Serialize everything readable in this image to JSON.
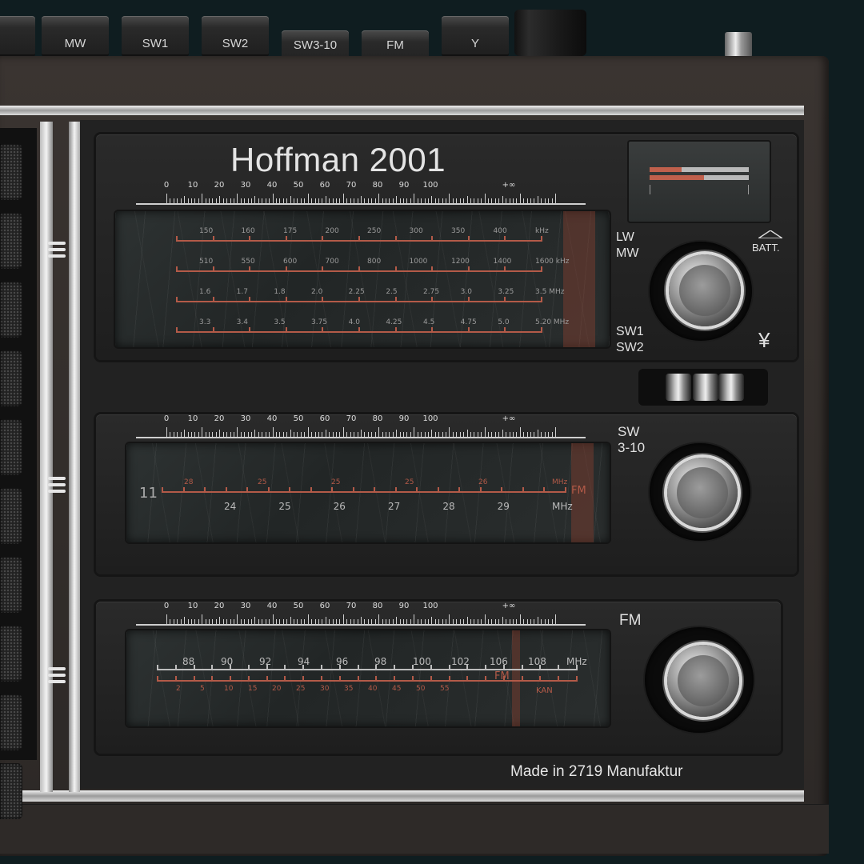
{
  "brand": "Hoffman 2001",
  "footer": "Made in 2719 Manufaktur",
  "keys": [
    {
      "label": "",
      "name": "key-lw"
    },
    {
      "label": "MW",
      "name": "key-mw"
    },
    {
      "label": "SW1",
      "name": "key-sw1"
    },
    {
      "label": "SW2",
      "name": "key-sw2"
    },
    {
      "label": "SW3-10",
      "name": "key-sw3-10"
    },
    {
      "label": "FM",
      "name": "key-fm"
    },
    {
      "label": "Y",
      "name": "key-antenna"
    }
  ],
  "scale_numbers": [
    "0",
    "10",
    "20",
    "30",
    "40",
    "50",
    "60",
    "70",
    "80",
    "90",
    "100",
    "+∞"
  ],
  "panel1": {
    "labels_top": [
      "LW",
      "MW"
    ],
    "labels_bottom": [
      "SW1",
      "SW2"
    ],
    "batt": "BATT.",
    "antenna_symbol": "¥",
    "rows": [
      [
        "150",
        "160",
        "175",
        "200",
        "250",
        "300",
        "350",
        "400",
        "kHz"
      ],
      [
        "510",
        "550",
        "600",
        "700",
        "800",
        "1000",
        "1200",
        "1400",
        "1600 kHz"
      ],
      [
        "1.6",
        "1.7",
        "1.8",
        "2.0",
        "2.25",
        "2.5",
        "2.75",
        "3.0",
        "3.25",
        "3.5 MHz"
      ],
      [
        "3.3",
        "3.4",
        "3.5",
        "3.75",
        "4.0",
        "4.25",
        "4.5",
        "4.75",
        "5.0",
        "5.20 MHz"
      ]
    ]
  },
  "panel2": {
    "label": "SW\n3-10",
    "band_number": "11",
    "upper": [
      "28",
      "25",
      "25",
      "25",
      "26",
      "MHz"
    ],
    "lower": [
      "24",
      "25",
      "26",
      "27",
      "28",
      "29",
      "MHz"
    ],
    "marker": "FM"
  },
  "panel3": {
    "label": "FM",
    "upper": [
      "88",
      "90",
      "92",
      "94",
      "96",
      "98",
      "100",
      "102",
      "106",
      "108",
      "MHz"
    ],
    "lower": [
      "2",
      "5",
      "10",
      "15",
      "20",
      "25",
      "30",
      "35",
      "40",
      "45",
      "50",
      "55"
    ],
    "marker": "FM",
    "kan": "KAN"
  },
  "colors": {
    "accent_red": "#b35a48",
    "chrome": "#d9d9d9",
    "panel": "#222222",
    "wood": "#332e2b"
  }
}
